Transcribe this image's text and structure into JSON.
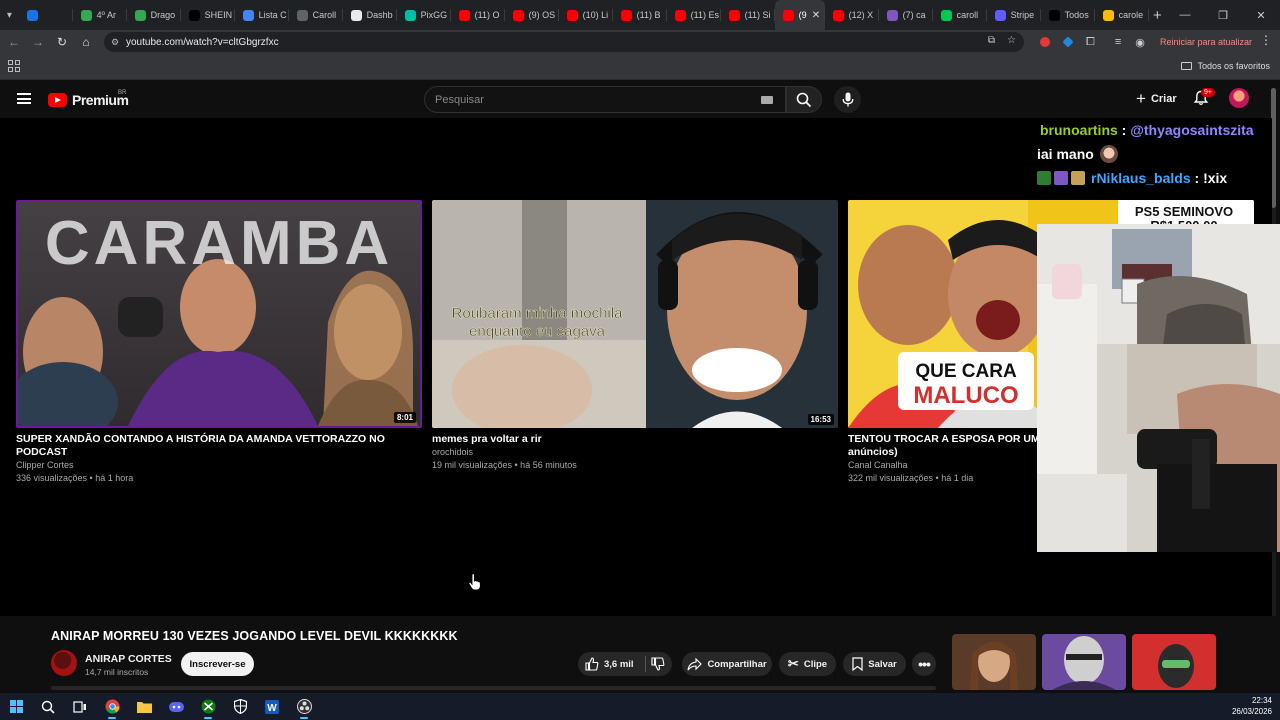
{
  "browser": {
    "tabs": [
      {
        "label": "",
        "color": "#1a73e8",
        "active": false
      },
      {
        "label": "4º Ar",
        "color": "#34a853",
        "active": false
      },
      {
        "label": "Drago",
        "color": "#34a853",
        "active": false
      },
      {
        "label": "SHEIN",
        "color": "#000000",
        "active": false
      },
      {
        "label": "Lista C",
        "color": "#4285f4",
        "active": false
      },
      {
        "label": "Caroll",
        "color": "#5f6368",
        "active": false
      },
      {
        "label": "Dashb",
        "color": "#e8eaed",
        "active": false
      },
      {
        "label": "PixGG",
        "color": "#00bfa5",
        "active": false
      },
      {
        "label": "(11) O",
        "color": "#ff0000",
        "active": false
      },
      {
        "label": "(9) OS",
        "color": "#ff0000",
        "active": false
      },
      {
        "label": "(10) Li",
        "color": "#ff0000",
        "active": false
      },
      {
        "label": "(11) B",
        "color": "#ff0000",
        "active": false
      },
      {
        "label": "(11) Es",
        "color": "#ff0000",
        "active": false
      },
      {
        "label": "(11) Si",
        "color": "#ff0000",
        "active": false
      },
      {
        "label": "(9",
        "color": "#ff0000",
        "active": true
      },
      {
        "label": "(12) X",
        "color": "#ff0000",
        "active": false
      },
      {
        "label": "(7) ca",
        "color": "#7e57c2",
        "active": false
      },
      {
        "label": "caroll",
        "color": "#00c853",
        "active": false
      },
      {
        "label": "Stripe",
        "color": "#635bff",
        "active": false
      },
      {
        "label": "Todos",
        "color": "#000000",
        "active": false
      },
      {
        "label": "carole",
        "color": "#fbbc04",
        "active": false
      }
    ],
    "url": "youtube.com/watch?v=cltGbgrzfxc",
    "update_label": "Reiniciar para atualizar",
    "all_favorites": "Todos os favoritos"
  },
  "youtube": {
    "logo_text": "Premium",
    "logo_region": "BR",
    "search_placeholder": "Pesquisar",
    "create_label": "Criar",
    "notification_count": "9+"
  },
  "end_screen": [
    {
      "title": "SUPER XANDÃO CONTANDO A HISTÓRIA DA AMANDA VETTORAZZO NO PODCAST",
      "channel": "Clipper Cortes",
      "meta": "336 visualizações • há 1 hora",
      "duration": "8:01",
      "thumb_text": "CARAMBA"
    },
    {
      "title": "memes pra voltar a rir",
      "channel": "orochidois",
      "meta": "19 mil visualizações • há 56 minutos",
      "duration": "16:53",
      "thumb_text_1": "Roubaram minha mochila",
      "thumb_text_2": "enquanto eu cagava"
    },
    {
      "title": "TENTOU TROCAR A ESPOSA POR UM",
      "title_cont": "anúncios)",
      "channel": "Canal Canalha",
      "meta": "322 mil visualizações • há 1 dia",
      "thumb_text_1": "QUE CARA",
      "thumb_text_2": "MALUCO",
      "thumb_text_3": "PS5 SEMINOVO",
      "thumb_text_4": "R$1.500,00"
    }
  ],
  "chat": [
    {
      "user": "brunoartins",
      "sep": " : ",
      "msg": "@thyagosaintszita"
    },
    {
      "msg": "iai mano"
    },
    {
      "user": "rNiklaus_balds",
      "sep": " : ",
      "msg": "!xix"
    }
  ],
  "video": {
    "title": "ANIRAP MORREU 130 VEZES JOGANDO LEVEL DEVIL KKKKKKKK",
    "channel": "ANIRAP CORTES",
    "subscribers": "14,7 mil inscritos",
    "subscribe_label": "Inscrever-se",
    "likes": "3,6 mil",
    "share_label": "Compartilhar",
    "clip_label": "Clipe",
    "save_label": "Salvar"
  },
  "taskbar": {
    "time": "22:34",
    "date": "26/03/2026"
  }
}
